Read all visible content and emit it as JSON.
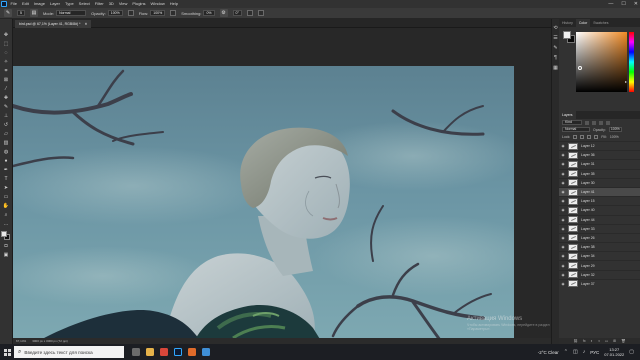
{
  "menubar": {
    "items": [
      "File",
      "Edit",
      "Image",
      "Layer",
      "Type",
      "Select",
      "Filter",
      "3D",
      "View",
      "Plugins",
      "Window",
      "Help"
    ],
    "window_controls": [
      "—",
      "☐",
      "✕"
    ]
  },
  "options": {
    "brush_size": "5",
    "mode_label": "Mode:",
    "mode_value": "Normal",
    "opacity_label": "Opacity:",
    "opacity_value": "100%",
    "flow_label": "Flow:",
    "flow_value": "100%",
    "smoothing_label": "Smoothing:",
    "smoothing_value": "0%",
    "angle_value": "0°"
  },
  "document": {
    "tab_title": "bird.psd @ 67,1% (Layer 41, RGB/8#) *",
    "close": "✕"
  },
  "status": {
    "zoom": "67,14%",
    "info": "3000 px x 3000 px (72 ppi)"
  },
  "watermark": {
    "title": "Активация Windows",
    "subtitle": "Чтобы активировать Windows, перейдите в раздел «Параметры»."
  },
  "color_panel": {
    "tabs": [
      "History",
      "Color",
      "Swatches"
    ],
    "active_tab": "Color"
  },
  "layers_panel": {
    "tabs": [
      "Layers"
    ],
    "kind_value": "Kind",
    "mode_value": "Normal",
    "opacity_label": "Opacity:",
    "opacity_value": "100%",
    "lock_label": "Lock:",
    "fill_label": "Fill:",
    "fill_value": "100%",
    "layers": [
      {
        "name": "Layer 12",
        "active": false
      },
      {
        "name": "Layer 36",
        "active": false
      },
      {
        "name": "Layer 31",
        "active": false
      },
      {
        "name": "Layer 35",
        "active": false
      },
      {
        "name": "Layer 30",
        "active": false
      },
      {
        "name": "Layer 41",
        "active": true
      },
      {
        "name": "Layer 15",
        "active": false
      },
      {
        "name": "Layer 40",
        "active": false
      },
      {
        "name": "Layer 44",
        "active": false
      },
      {
        "name": "Layer 33",
        "active": false
      },
      {
        "name": "Layer 26",
        "active": false
      },
      {
        "name": "Layer 38",
        "active": false
      },
      {
        "name": "Layer 34",
        "active": false
      },
      {
        "name": "Layer 29",
        "active": false
      },
      {
        "name": "Layer 32",
        "active": false
      },
      {
        "name": "Layer 37",
        "active": false
      }
    ],
    "footer_icons": [
      "link-icon",
      "fx-icon",
      "mask-icon",
      "adjustment-icon",
      "group-icon",
      "new-layer-icon",
      "trash-icon"
    ]
  },
  "taskbar": {
    "search_placeholder": "Введите здесь текст для поиска",
    "weather": "-2°C  Clear",
    "language": "РУС",
    "time": "13:27",
    "date": "07.01.2022"
  },
  "colors": {
    "foreground": "#f2f2f2",
    "background": "#0a0a0a",
    "accent_blue": "#31a8ff",
    "sky": "#6f9aa8"
  }
}
